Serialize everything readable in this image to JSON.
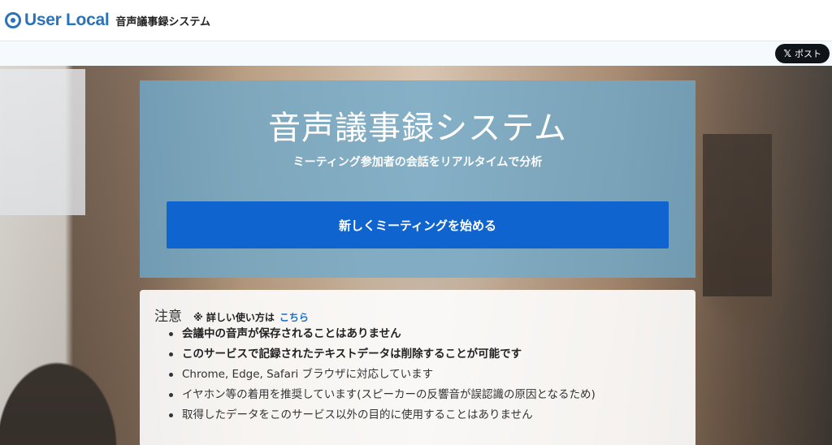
{
  "header": {
    "logo_text": "User Local",
    "app_name": "音声議事録システム"
  },
  "share": {
    "x_glyph": "𝕏",
    "post_label": "ポスト"
  },
  "hero": {
    "title": "音声議事録システム",
    "subtitle": "ミーティング参加者の会話をリアルタイムで分析",
    "start_button": "新しくミーティングを始める"
  },
  "notice": {
    "title": "注意",
    "note": "※ 詳しい使い方は",
    "link_text": "こちら",
    "items": [
      {
        "text": "会議中の音声が保存されることはありません",
        "bold": true
      },
      {
        "text": "このサービスで記録されたテキストデータは削除することが可能です",
        "bold": true
      },
      {
        "text": "Chrome, Edge, Safari ブラウザに対応しています",
        "bold": false
      },
      {
        "text": "イヤホン等の着用を推奨しています(スピーカーの反響音が誤認識の原因となるため)",
        "bold": false
      },
      {
        "text": "取得したデータをこのサービス以外の目的に使用することはありません",
        "bold": false
      }
    ]
  },
  "colors": {
    "brand": "#2b73b8",
    "primary_button": "#0f64cf",
    "link": "#1a6fc4"
  }
}
